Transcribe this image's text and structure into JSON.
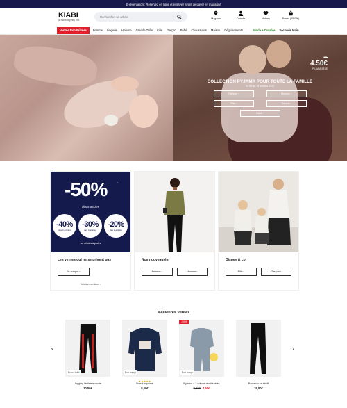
{
  "topbar": {
    "text": "E-réservation : Réservez en ligne et essayez avant de payer en magasin!"
  },
  "header": {
    "logo": "KIABI",
    "tagline": "la mode à petits prix",
    "search_placeholder": "Recherchez un article",
    "icons": [
      {
        "label": "Magasin",
        "icon": "store-pin-icon"
      },
      {
        "label": "Compte",
        "icon": "user-icon"
      },
      {
        "label": "Vitrines",
        "icon": "heart-icon"
      },
      {
        "label": "Panier (25.00€)",
        "icon": "basket-icon"
      }
    ]
  },
  "nav": {
    "sale": "Ventes Non Privées",
    "items": [
      "Femme",
      "Lingerie",
      "Homme",
      "Grande Taille",
      "Fille",
      "Garçon",
      "Bébé",
      "Chaussures",
      "Maison",
      "Déguisements"
    ],
    "green": "Mode + Durable",
    "bold": "Seconde Main"
  },
  "hero": {
    "old_price": "9€",
    "new_price": "4.50€",
    "price_label": "PYJAMA BÉBÉ",
    "title": "COLLECTION PYJAMA POUR TOUTE LA FAMILLE",
    "dates": "Du 06 au 16 octobre 2022",
    "buttons": [
      "Femme ›",
      "Homme ›",
      "Fille ›",
      "Garçon ›",
      "Bébé ›"
    ]
  },
  "cards": [
    {
      "big": "-50%",
      "star": "*",
      "sub": "dès 5 articles",
      "circles": [
        {
          "value": "-40%",
          "desc": "dès 4 articles"
        },
        {
          "value": "-30%",
          "desc": "dès 3 articles"
        },
        {
          "value": "-20%",
          "desc": "dès 2 articles"
        }
      ],
      "bottom": "sur articles signalés",
      "title": "Les ventes qui ne se privent pas",
      "buttons": [
        "Je craque ›"
      ],
      "link": "Voir les mentions ›"
    },
    {
      "title": "Nos nouveautés",
      "buttons": [
        "Femme ›",
        "Homme ›"
      ]
    },
    {
      "title": "Disney & co",
      "buttons": [
        "Fille ›",
        "Garçon ›"
      ]
    }
  ],
  "best": {
    "title": "Meilleures ventes",
    "prev": "‹",
    "next": "›",
    "products": [
      {
        "badge": "Ecko Unltd",
        "name": "Jogging fantaisie mode",
        "price": "10,00€"
      },
      {
        "badge": "Eco-conçu",
        "name": "Sweat imprimé",
        "price": "8,00€",
        "stars": "★★★★★"
      },
      {
        "badge": "Eco-conçu",
        "discount": "-50%",
        "name": "Pyjama + 2 cotons réutilisables",
        "old": "9,00€",
        "price": "4,50€"
      },
      {
        "name": "Pantalon en simili",
        "price": "15,00€"
      }
    ]
  }
}
